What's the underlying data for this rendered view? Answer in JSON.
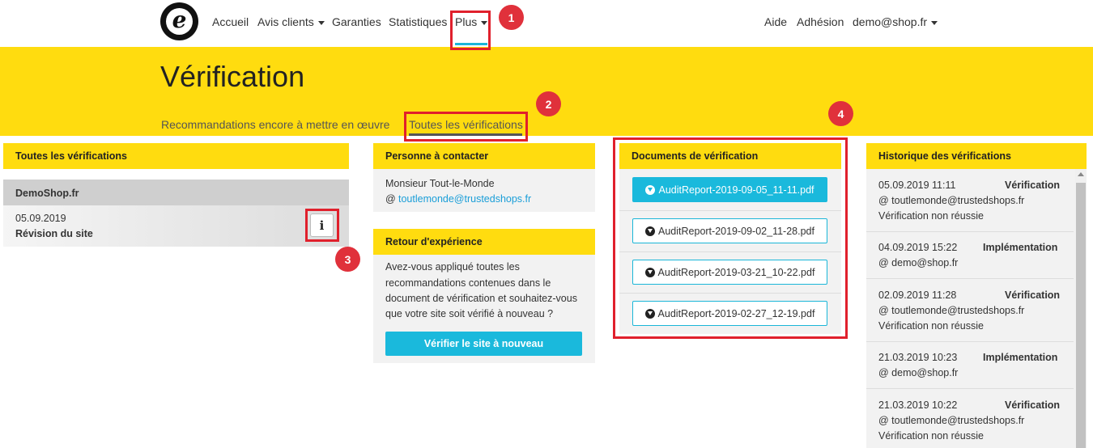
{
  "nav": {
    "logo_letter": "e",
    "items": [
      "Accueil",
      "Avis clients",
      "Garanties",
      "Statistiques",
      "Plus"
    ],
    "right": [
      "Aide",
      "Adhésion",
      "demo@shop.fr"
    ]
  },
  "callouts": [
    "1",
    "2",
    "3",
    "4"
  ],
  "page": {
    "title": "Vérification",
    "tabs": [
      "Recommandations encore à mettre en œuvre",
      "Toutes les vérifications"
    ]
  },
  "all_verifications": {
    "title": "Toutes les vérifications",
    "site": "DemoShop.fr",
    "date": "05.09.2019",
    "type": "Révision du site",
    "info": "i"
  },
  "contact": {
    "title": "Personne à contacter",
    "name": "Monsieur Tout-le-Monde",
    "at": "@",
    "email": "toutlemonde@trustedshops.fr"
  },
  "feedback": {
    "title": "Retour d'expérience",
    "lines": [
      "Avez-vous appliqué toutes les",
      "recommandations contenues dans le",
      "document de vérification et souhaitez-vous",
      "que votre site soit vérifié à nouveau ?"
    ],
    "button": "Vérifier le site à nouveau"
  },
  "documents": {
    "title": "Documents de vérification",
    "files": [
      "AuditReport-2019-09-05_11-11.pdf",
      "AuditReport-2019-09-02_11-28.pdf",
      "AuditReport-2019-03-21_10-22.pdf",
      "AuditReport-2019-02-27_12-19.pdf"
    ]
  },
  "history": {
    "title": "Historique des vérifications",
    "entries": [
      {
        "date": "05.09.2019 11:11",
        "type": "Vérification",
        "user": "@ toutlemonde@trustedshops.fr",
        "status": "Vérification non réussie"
      },
      {
        "date": "04.09.2019 15:22",
        "type": "Implémentation",
        "user": "@ demo@shop.fr",
        "status": ""
      },
      {
        "date": "02.09.2019 11:28",
        "type": "Vérification",
        "user": "@ toutlemonde@trustedshops.fr",
        "status": "Vérification non réussie"
      },
      {
        "date": "21.03.2019 10:23",
        "type": "Implémentation",
        "user": "@ demo@shop.fr",
        "status": ""
      },
      {
        "date": "21.03.2019 10:22",
        "type": "Vérification",
        "user": "@ toutlemonde@trustedshops.fr",
        "status": "Vérification non réussie"
      }
    ]
  },
  "colors": {
    "brand_yellow": "#ffdc0f",
    "accent_blue": "#1ab9dc",
    "callout_red": "#e0202c"
  }
}
